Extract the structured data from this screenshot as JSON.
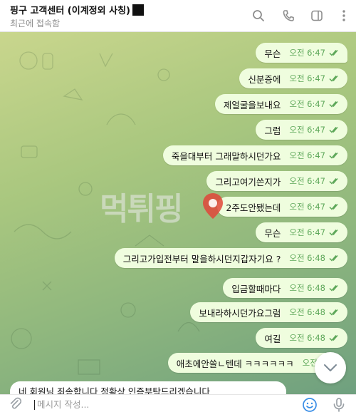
{
  "header": {
    "title": "핑구 고객센터 (이계정외 사칭)",
    "status": "최근에 접속함",
    "icons": [
      "search-icon",
      "phone-icon",
      "sidebar-toggle-icon",
      "more-vert-icon"
    ]
  },
  "watermark": {
    "text": "먹튀핑"
  },
  "messages": [
    {
      "text": "무슨",
      "time": "오전 6:47"
    },
    {
      "text": "신분증에",
      "time": "오전 6:47"
    },
    {
      "text": "제얼굴을보내요",
      "time": "오전 6:47"
    },
    {
      "text": "그럼",
      "time": "오전 6:47"
    },
    {
      "text": "죽을대부터 그래말하시던가요",
      "time": "오전 6:47"
    },
    {
      "text": "그리고여기쓴지가",
      "time": "오전 6:47"
    },
    {
      "text": "2주도안됐는데",
      "time": "오전 6:47"
    },
    {
      "text": "무슨",
      "time": "오전 6:47"
    },
    {
      "text": "그리고가입전부터 말을하시던지갑자기요 ?",
      "time": "오전 6:48"
    },
    {
      "text": "입금할때마다",
      "time": "오전 6:48"
    },
    {
      "text": "보내라하시던가요그럼",
      "time": "오전 6:48"
    },
    {
      "text": "여길",
      "time": "오전 6:48"
    },
    {
      "text": "애초에안쓸ㄴ텐데 ㅋㅋㅋㅋㅋㅋ",
      "time": "오전 6:4"
    }
  ],
  "incoming_partial": {
    "text": "네 회원님 죄송합니다 정확상 인증부탁드리겠습니다"
  },
  "composer": {
    "placeholder": "메시지 작성..."
  },
  "colors": {
    "outgoing_bubble": "#effdde",
    "time_green": "#5ea85a",
    "icon_gray": "#8d8d8d",
    "accent_blue": "#3a8ee6"
  }
}
